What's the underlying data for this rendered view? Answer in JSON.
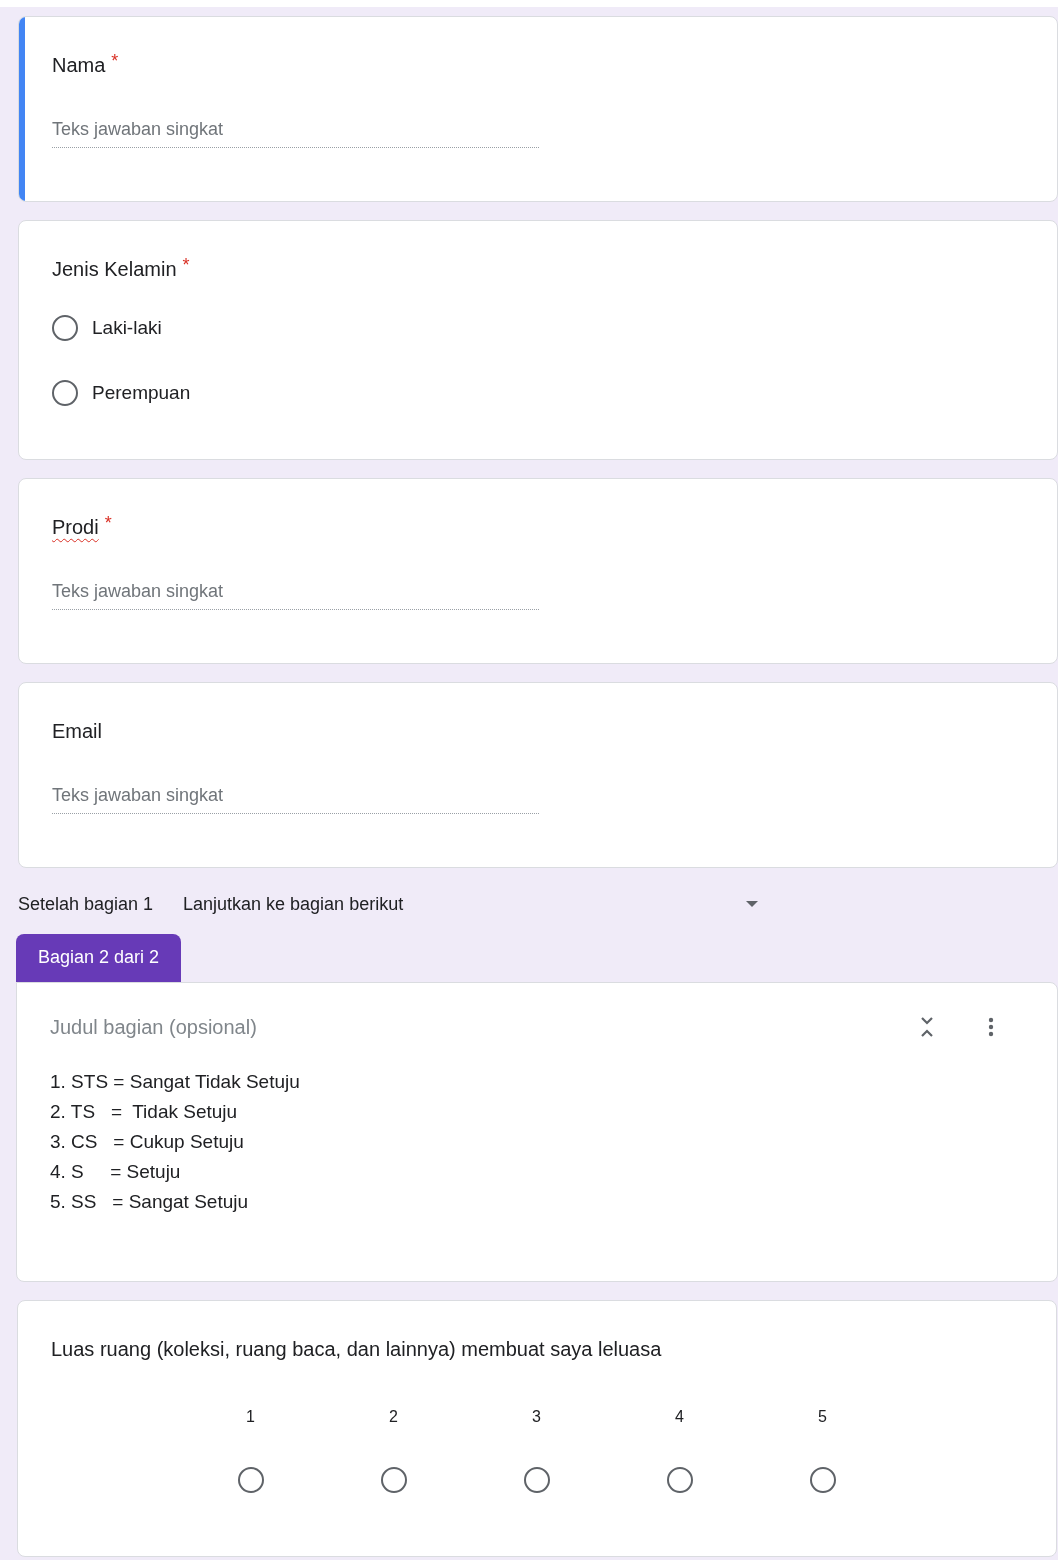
{
  "questions": [
    {
      "kind": "short_text",
      "title": "Nama",
      "required_mark": "*",
      "focused": true,
      "placeholder": "Teks jawaban singkat"
    },
    {
      "kind": "radio",
      "title": "Jenis Kelamin",
      "required_mark": "*",
      "focused": false,
      "options": [
        {
          "label": "Laki-laki",
          "selected": false
        },
        {
          "label": "Perempuan",
          "selected": false
        }
      ]
    },
    {
      "kind": "short_text",
      "title": "Prodi",
      "required_mark": "*",
      "focused": false,
      "misspelled": true,
      "placeholder": "Teks jawaban singkat"
    },
    {
      "kind": "short_text",
      "title": "Email",
      "focused": false,
      "placeholder": "Teks jawaban singkat"
    }
  ],
  "navigation": {
    "label": "Setelah bagian 1",
    "value": "Lanjutkan ke bagian berikut"
  },
  "section_tab": "Bagian 2 dari 2",
  "section": {
    "title_placeholder": "Judul bagian (opsional)",
    "description": [
      "1. STS = Sangat Tidak Setuju",
      "2. TS   =  Tidak Setuju",
      "3. CS   = Cukup Setuju",
      "4. S     = Setuju",
      "5. SS   = Sangat Setuju"
    ]
  },
  "scale_question": {
    "title": "Luas ruang (koleksi, ruang baca, dan lainnya) membuat saya leluasa",
    "options": [
      {
        "label": "1",
        "selected": false
      },
      {
        "label": "2",
        "selected": false
      },
      {
        "label": "3",
        "selected": false
      },
      {
        "label": "4",
        "selected": false
      },
      {
        "label": "5",
        "selected": false
      }
    ]
  }
}
